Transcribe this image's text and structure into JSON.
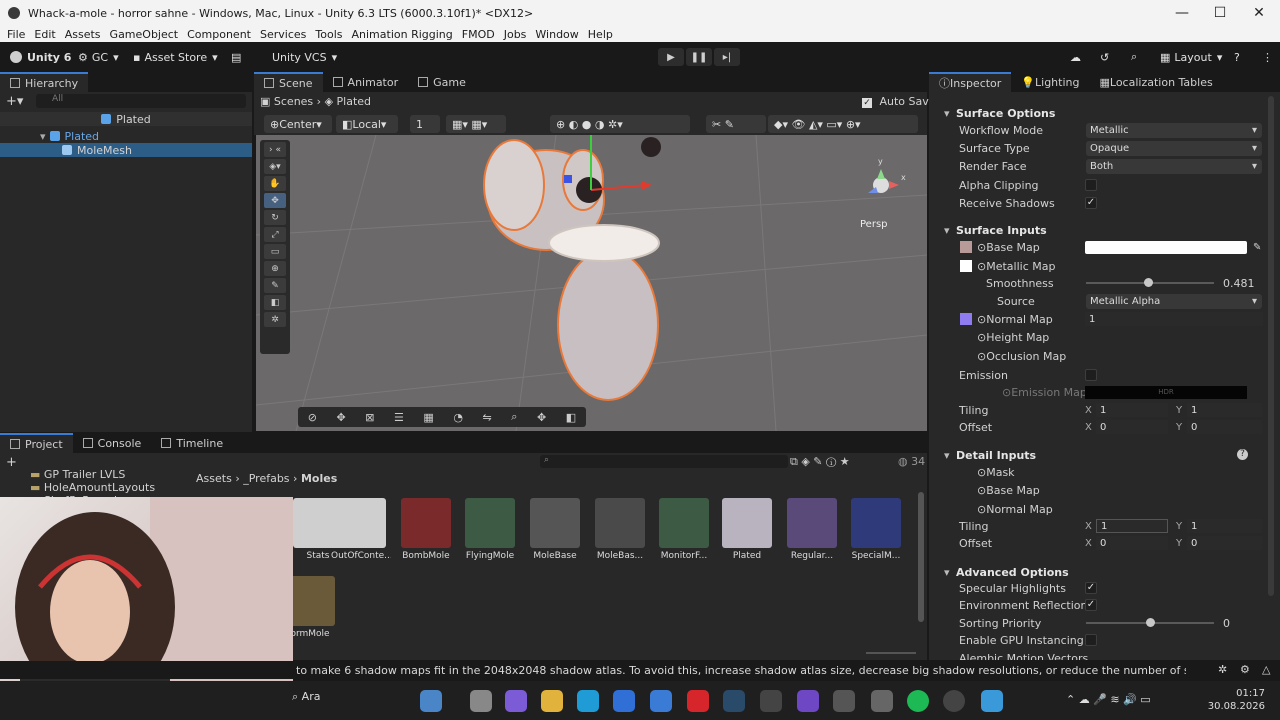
{
  "window": {
    "title": "Whack-a-mole - horror sahne - Windows, Mac, Linux - Unity 6.3 LTS (6000.3.10f1)* <DX12>",
    "minimize": "—",
    "maximize": "☐",
    "close": "✕"
  },
  "menu": [
    "File",
    "Edit",
    "Assets",
    "GameObject",
    "Component",
    "Services",
    "Tools",
    "Animation Rigging",
    "FMOD",
    "Jobs",
    "Window",
    "Help"
  ],
  "toolbar": {
    "unity_label": "Unity 6",
    "account_label": "GC",
    "asset_store_label": "Asset Store",
    "vcs_label": "Unity VCS",
    "layout_label": "Layout"
  },
  "hierarchy": {
    "tab_label": "Hierarchy",
    "search_placeholder": "All",
    "scene_label": "Plated",
    "items": [
      "Plated",
      "MoleMesh"
    ]
  },
  "scene": {
    "tabs": [
      "Scene",
      "Animator",
      "Game"
    ],
    "breadcrumb_root": "Scenes",
    "breadcrumb_current": "Plated",
    "auto_save": "Auto Save",
    "pivot": "Center",
    "space": "Local",
    "grid_count": "1",
    "persp_label": "Persp"
  },
  "inspector": {
    "tabs": [
      "Inspector",
      "Lighting",
      "Localization Tables"
    ],
    "surface_options": {
      "heading": "Surface Options",
      "workflow_mode_label": "Workflow Mode",
      "workflow_mode_value": "Metallic",
      "surface_type_label": "Surface Type",
      "surface_type_value": "Opaque",
      "render_face_label": "Render Face",
      "render_face_value": "Both",
      "alpha_clipping_label": "Alpha Clipping",
      "receive_shadows_label": "Receive Shadows"
    },
    "surface_inputs": {
      "heading": "Surface Inputs",
      "base_map_label": "Base Map",
      "metallic_map_label": "Metallic Map",
      "smoothness_label": "Smoothness",
      "smoothness_value": "0.481",
      "smoothness_level": 0.481,
      "source_label": "Source",
      "source_value": "Metallic Alpha",
      "normal_map_label": "Normal Map",
      "normal_map_value": "1",
      "height_map_label": "Height Map",
      "occlusion_map_label": "Occlusion Map",
      "emission_label": "Emission",
      "emission_map_label": "Emission Map",
      "emission_hdr": "HDR",
      "tiling_label": "Tiling",
      "tiling_x": "1",
      "tiling_y": "1",
      "offset_label": "Offset",
      "offset_x": "0",
      "offset_y": "0"
    },
    "detail_inputs": {
      "heading": "Detail Inputs",
      "mask_label": "Mask",
      "base_map_label": "Base Map",
      "normal_map_label": "Normal Map",
      "tiling_label": "Tiling",
      "tiling_x": "1",
      "tiling_y": "1",
      "offset_label": "Offset",
      "offset_x": "0",
      "offset_y": "0"
    },
    "advanced_options": {
      "heading": "Advanced Options",
      "specular_label": "Specular Highlights",
      "env_reflections_label": "Environment Reflections",
      "sorting_priority_label": "Sorting Priority",
      "sorting_priority_value": "0",
      "gpu_instancing_label": "Enable GPU Instancing",
      "alembic_label": "Alembic Motion Vectors"
    },
    "axis_x": "X",
    "axis_y": "Y"
  },
  "project": {
    "tabs": [
      "Project",
      "Console",
      "Timeline"
    ],
    "folders": [
      "GP Trailer LVLS",
      "HoleAmountLayouts",
      "ShuffleRounds"
    ],
    "breadcrumb": [
      "Assets",
      "_Prefabs",
      "Moles"
    ],
    "item_count": "34",
    "assets": [
      "Stats",
      "OutOfConte...",
      "BombMole",
      "FlyingMole",
      "MoleBase",
      "MoleBas...",
      "MonitorF...",
      "Plated",
      "Regular...",
      "SpecialM..."
    ],
    "assets_row2": [
      "ormMole"
    ]
  },
  "status": {
    "message": "to make 6 shadow maps fit in the 2048x2048 shadow atlas. To avoid this, increase shadow atlas size, decrease big shadow resolutions, or reduce the number of shadow maps active in the"
  },
  "taskbar": {
    "search_text": "Ara",
    "time": "01:17",
    "date": "30.08.2026"
  },
  "colors": {
    "accent": "#3a7bd5",
    "selection": "#2c5d87",
    "panel": "#282828",
    "toolbar": "#191919"
  }
}
